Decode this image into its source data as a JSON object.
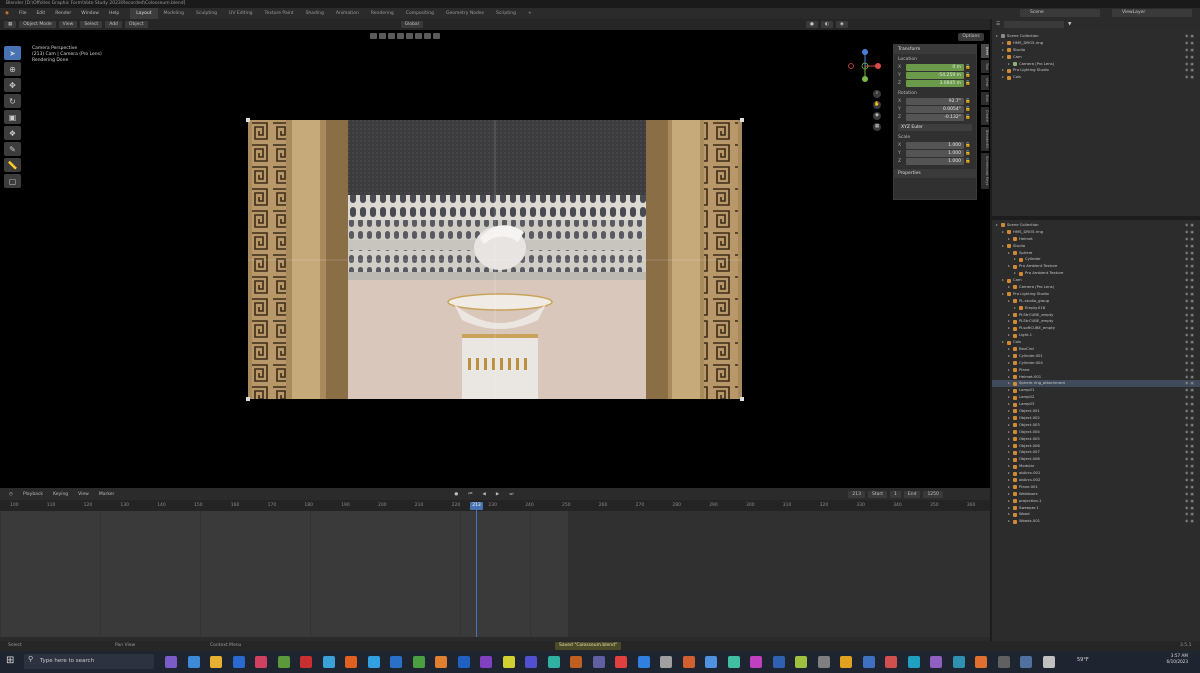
{
  "window": {
    "title": "Blender [D:\\Offsites Graphic Form\\Vote Study 2023\\Recorded\\Colosseum.blend]"
  },
  "menubar": {
    "menus": [
      "File",
      "Edit",
      "Render",
      "Window",
      "Help"
    ],
    "workspaces": [
      {
        "label": "Layout",
        "active": true
      },
      {
        "label": "Modeling",
        "active": false
      },
      {
        "label": "Sculpting",
        "active": false
      },
      {
        "label": "UV Editing",
        "active": false
      },
      {
        "label": "Texture Paint",
        "active": false
      },
      {
        "label": "Shading",
        "active": false
      },
      {
        "label": "Animation",
        "active": false
      },
      {
        "label": "Rendering",
        "active": false
      },
      {
        "label": "Compositing",
        "active": false
      },
      {
        "label": "Geometry Nodes",
        "active": false
      },
      {
        "label": "Scripting",
        "active": false
      }
    ],
    "scene_label": "Scene",
    "viewlayer_label": "ViewLayer"
  },
  "tool_header": {
    "mode": "Object Mode",
    "menus": [
      "View",
      "Select",
      "Add",
      "Object"
    ],
    "transform_orientation": "Global",
    "options_label": "Options"
  },
  "viewport": {
    "info_lines": [
      "Camera Perspective",
      "(213) Cam | Camera (Pro Lens)",
      "Rendering Done"
    ]
  },
  "transform_panel": {
    "title": "Transform",
    "location_label": "Location",
    "location": [
      {
        "axis": "X",
        "value": "0 m"
      },
      {
        "axis": "Y",
        "value": "-54.259 m"
      },
      {
        "axis": "Z",
        "value": "3.0845 m"
      }
    ],
    "rotation_label": "Rotation",
    "rotation": [
      {
        "axis": "X",
        "value": "92.7°"
      },
      {
        "axis": "Y",
        "value": "0.0054°"
      },
      {
        "axis": "Z",
        "value": "-0.132°"
      }
    ],
    "rotation_mode": "XYZ Euler",
    "scale_label": "Scale",
    "scale": [
      {
        "axis": "X",
        "value": "1.000"
      },
      {
        "axis": "Y",
        "value": "1.000"
      },
      {
        "axis": "Z",
        "value": "1.000"
      }
    ],
    "properties_label": "Properties"
  },
  "side_tabs": [
    "Item",
    "Tool",
    "View",
    "Edit",
    "Create",
    "BlenderKit",
    "Screencast Keys"
  ],
  "timeline": {
    "menus": [
      "Playback",
      "Keying",
      "View",
      "Marker"
    ],
    "current_frame": "213",
    "start_label": "Start",
    "start": "1",
    "end_label": "End",
    "end": "1250",
    "ruler_ticks": [
      "100",
      "110",
      "120",
      "130",
      "140",
      "150",
      "160",
      "170",
      "180",
      "190",
      "200",
      "210",
      "220",
      "230",
      "240",
      "250",
      "260",
      "270",
      "280",
      "290",
      "300",
      "310",
      "320",
      "330",
      "340",
      "350",
      "360"
    ]
  },
  "outliner_top": {
    "rows": [
      {
        "label": "Scene Collection",
        "depth": 0,
        "color": "#8a8a8a"
      },
      {
        "label": "HMS_DRO5.ring",
        "depth": 1,
        "color": "#cc8a3a"
      },
      {
        "label": "Studio",
        "depth": 1,
        "color": "#cc8a3a"
      },
      {
        "label": "Cam",
        "depth": 1,
        "color": "#cc8a3a"
      },
      {
        "label": "Camera (Pro Lens)",
        "depth": 2,
        "color": "#8fb07a"
      },
      {
        "label": "Pro Lighting Studio",
        "depth": 1,
        "color": "#cc8a3a"
      },
      {
        "label": "Cols",
        "depth": 1,
        "color": "#cc8a3a"
      }
    ]
  },
  "outliner_main": {
    "rows": [
      {
        "label": "Scene Collection",
        "depth": 0
      },
      {
        "label": "HMS_DRO5.ring",
        "depth": 1
      },
      {
        "label": "Helmet",
        "depth": 2
      },
      {
        "label": "Studio",
        "depth": 1
      },
      {
        "label": "Sphere",
        "depth": 2
      },
      {
        "label": "Cylinder",
        "depth": 3
      },
      {
        "label": "Pro Ambient Texture",
        "depth": 2
      },
      {
        "label": "Pro Ambient Texture",
        "depth": 3
      },
      {
        "label": "Cam",
        "depth": 1
      },
      {
        "label": "Camera (Pro Lens)",
        "depth": 2
      },
      {
        "label": "Pro Lighting Studio",
        "depth": 1
      },
      {
        "label": "PL.studio_group",
        "depth": 2
      },
      {
        "label": "Empty.018",
        "depth": 3
      },
      {
        "label": "PLStrCUBE_empty",
        "depth": 2
      },
      {
        "label": "PLStrCUBE_empty",
        "depth": 2
      },
      {
        "label": "PLsoftCUBE_empty",
        "depth": 2
      },
      {
        "label": "Light.1",
        "depth": 2
      },
      {
        "label": "Cols",
        "depth": 1
      },
      {
        "label": "BezCircl",
        "depth": 2
      },
      {
        "label": "Cylinder.001",
        "depth": 2
      },
      {
        "label": "Cylinder.004",
        "depth": 2
      },
      {
        "label": "Plane",
        "depth": 2
      },
      {
        "label": "Helmet.001",
        "depth": 2
      },
      {
        "label": "Sphere.ring_attachment",
        "depth": 2,
        "highlight": true
      },
      {
        "label": "Lamp01",
        "depth": 2
      },
      {
        "label": "Lamp02",
        "depth": 2
      },
      {
        "label": "Lamp03",
        "depth": 2
      },
      {
        "label": "Object.001",
        "depth": 2
      },
      {
        "label": "Object.002",
        "depth": 2
      },
      {
        "label": "Object.003",
        "depth": 2
      },
      {
        "label": "Object.004",
        "depth": 2
      },
      {
        "label": "Object.005",
        "depth": 2
      },
      {
        "label": "Object.006",
        "depth": 2
      },
      {
        "label": "Object.007",
        "depth": 2
      },
      {
        "label": "Object.008",
        "depth": 2
      },
      {
        "label": "Modular",
        "depth": 2
      },
      {
        "label": "obArcs.001",
        "depth": 2
      },
      {
        "label": "obArcs.002",
        "depth": 2
      },
      {
        "label": "Plane.001",
        "depth": 2
      },
      {
        "label": "Walldoors",
        "depth": 2
      },
      {
        "label": "projection.1",
        "depth": 2
      },
      {
        "label": "Sweeper.1",
        "depth": 2
      },
      {
        "label": "Wood",
        "depth": 2
      },
      {
        "label": "Woods.001",
        "depth": 2
      }
    ]
  },
  "statusbar": {
    "left": "Select",
    "middle": "Pan View",
    "right": "Context Menu",
    "notice": "Saved \"Colosseum.blend\"",
    "version": "3.5.1"
  },
  "taskbar": {
    "search_placeholder": "Type here to search",
    "weather": "59°F",
    "time": "3:57 AM",
    "date": "6/10/2023"
  },
  "colors": {
    "accent_blue": "#4772b3",
    "location_green": "#6b9a4b",
    "axis_x": "#d94a4a",
    "axis_y": "#7ab94a",
    "axis_z": "#4a7fd9"
  }
}
